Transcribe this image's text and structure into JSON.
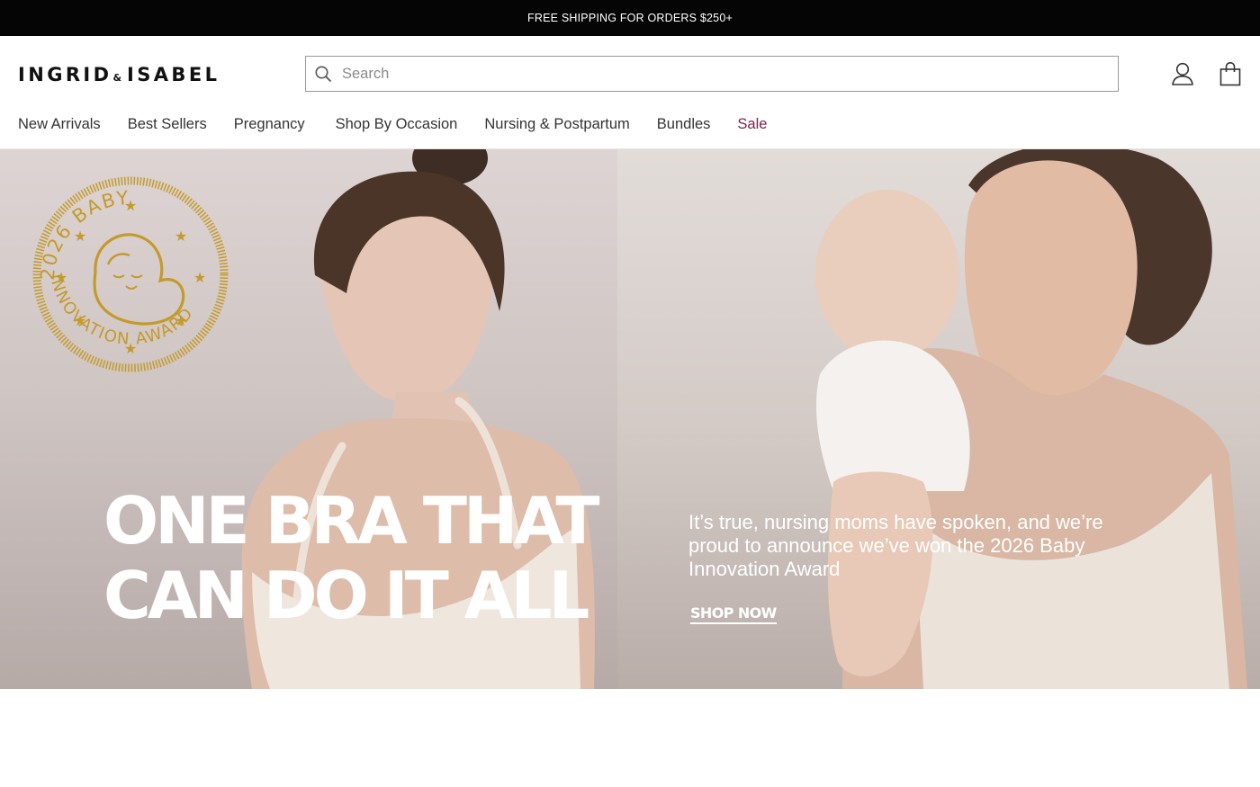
{
  "announcement": {
    "text": "FREE SHIPPING FOR ORDERS $250+"
  },
  "brand": {
    "name_left": "INGRID",
    "ampersand": "&",
    "name_right": "ISABEL"
  },
  "search": {
    "placeholder": "Search",
    "value": "",
    "icon": "search-icon"
  },
  "header_icons": {
    "account": "user-icon",
    "cart": "shopping-bag-icon"
  },
  "nav": {
    "items": [
      {
        "label": "New Arrivals"
      },
      {
        "label": "Best Sellers"
      },
      {
        "label": "Pregnancy"
      },
      {
        "label": "Shop By Occasion"
      },
      {
        "label": "Nursing & Postpartum"
      },
      {
        "label": "Bundles"
      },
      {
        "label": "Sale"
      }
    ]
  },
  "hero": {
    "headline_line1": "ONE BRA THAT",
    "headline_line2": "CAN DO IT ALL",
    "copy": "It’s true, nursing moms have spoken, and we’re proud to announce we’ve won the 2026 Baby Innovation Award",
    "cta": "SHOP NOW",
    "badge": {
      "text": "2026 BABY INNOVATION AWARD"
    }
  },
  "colors": {
    "announcement_bg": "#050505",
    "sale": "#7a2350",
    "badge_gold": "#c49a2a"
  }
}
